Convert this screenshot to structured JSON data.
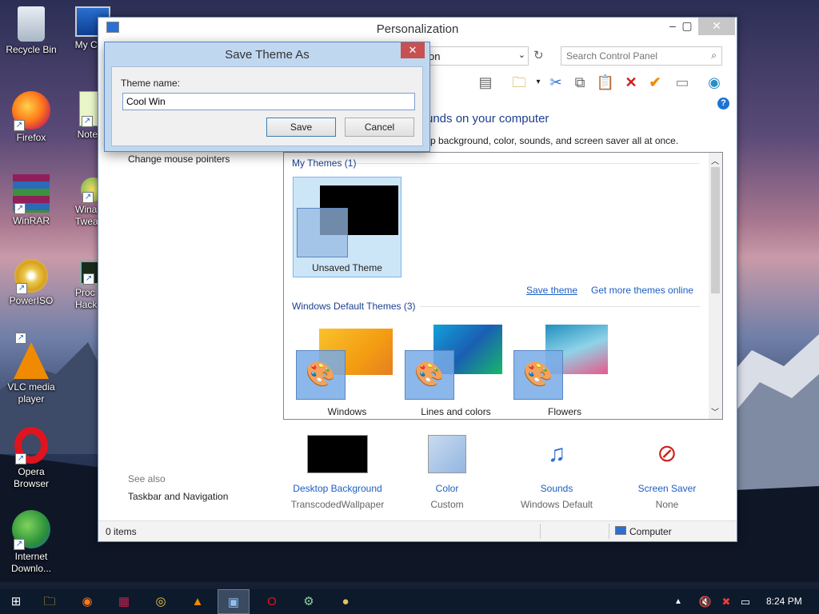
{
  "desktop": {
    "icons": [
      {
        "label": "Recycle Bin",
        "icon": "recycle-bin-icon"
      },
      {
        "label": "My Com",
        "icon": "computer-icon"
      },
      {
        "label": "Firefox",
        "icon": "firefox-icon"
      },
      {
        "label": "Notepa",
        "icon": "notepad-icon"
      },
      {
        "label": "WinRAR",
        "icon": "winrar-icon"
      },
      {
        "label": "Wina\nTwea",
        "icon": "winaero-icon"
      },
      {
        "label": "PowerISO",
        "icon": "poweriso-icon"
      },
      {
        "label": "Proc\nHack",
        "icon": "process-hacker-icon"
      },
      {
        "label": "VLC media\nplayer",
        "icon": "vlc-icon"
      },
      {
        "label": "Opera\nBrowser",
        "icon": "opera-icon"
      },
      {
        "label": "Internet\nDownlo...",
        "icon": "idm-icon"
      }
    ]
  },
  "window": {
    "title": "Personalization",
    "address_text": "on",
    "search_placeholder": "Search Control Panel",
    "heading": "unds on your computer",
    "subheading": "p background, color, sounds, and screen saver all at once.",
    "left_link": "Change mouse pointers",
    "see_also": "See also",
    "see_also_link": "Taskbar and Navigation",
    "my_themes_header": "My Themes (1)",
    "unsaved_theme": "Unsaved Theme",
    "save_theme": "Save theme",
    "get_more": "Get more themes online",
    "default_header": "Windows Default Themes (3)",
    "themes": [
      "Windows",
      "Lines and colors",
      "Flowers"
    ],
    "bottom": [
      {
        "title": "Desktop Background",
        "sub": "TranscodedWallpaper"
      },
      {
        "title": "Color",
        "sub": "Custom"
      },
      {
        "title": "Sounds",
        "sub": "Windows Default"
      },
      {
        "title": "Screen Saver",
        "sub": "None"
      }
    ],
    "status_items": "0 items",
    "status_location": "Computer"
  },
  "dialog": {
    "title": "Save Theme As",
    "label": "Theme name:",
    "value": "Cool Win",
    "save": "Save",
    "cancel": "Cancel"
  },
  "taskbar": {
    "time": "8:24 PM"
  },
  "colors": {
    "accent": "#1c5ec2",
    "selection": "#cde6f7",
    "dialog_frame": "#c0d7f0"
  }
}
